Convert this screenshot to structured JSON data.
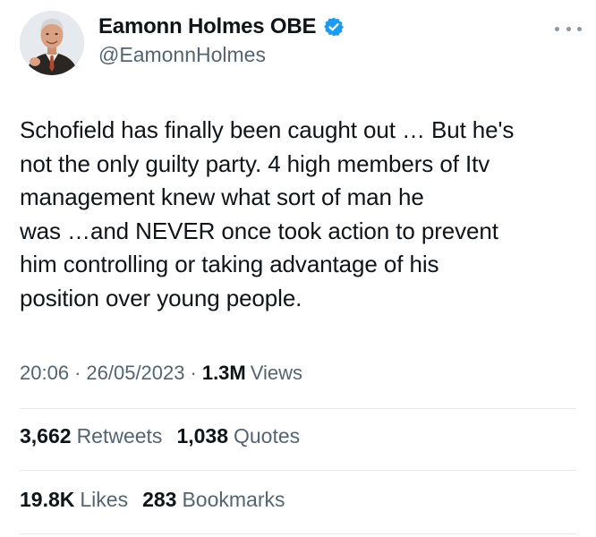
{
  "author": {
    "display_name": "Eamonn Holmes OBE",
    "handle": "@EamonnHolmes",
    "verified": true,
    "verified_color": "#1d9bf0",
    "avatar_icon": "profile-photo"
  },
  "more_icon": "ellipsis-icon",
  "tweet": {
    "text": "Schofield has finally been caught out … But he's\nnot the only guilty party. 4 high members of Itv\nmanagement knew what sort of man he\nwas …and NEVER once took action to prevent\nhim controlling or taking advantage of his\nposition over young people."
  },
  "meta": {
    "time": "20:06",
    "separator": "·",
    "date": "26/05/2023",
    "views_count": "1.3M",
    "views_label": "Views"
  },
  "engagement": {
    "retweets_count": "3,662",
    "retweets_label": "Retweets",
    "quotes_count": "1,038",
    "quotes_label": "Quotes",
    "likes_count": "19.8K",
    "likes_label": "Likes",
    "bookmarks_count": "283",
    "bookmarks_label": "Bookmarks"
  },
  "colors": {
    "text_primary": "#0f1419",
    "text_secondary": "#536471",
    "divider": "#e4e9ec"
  }
}
